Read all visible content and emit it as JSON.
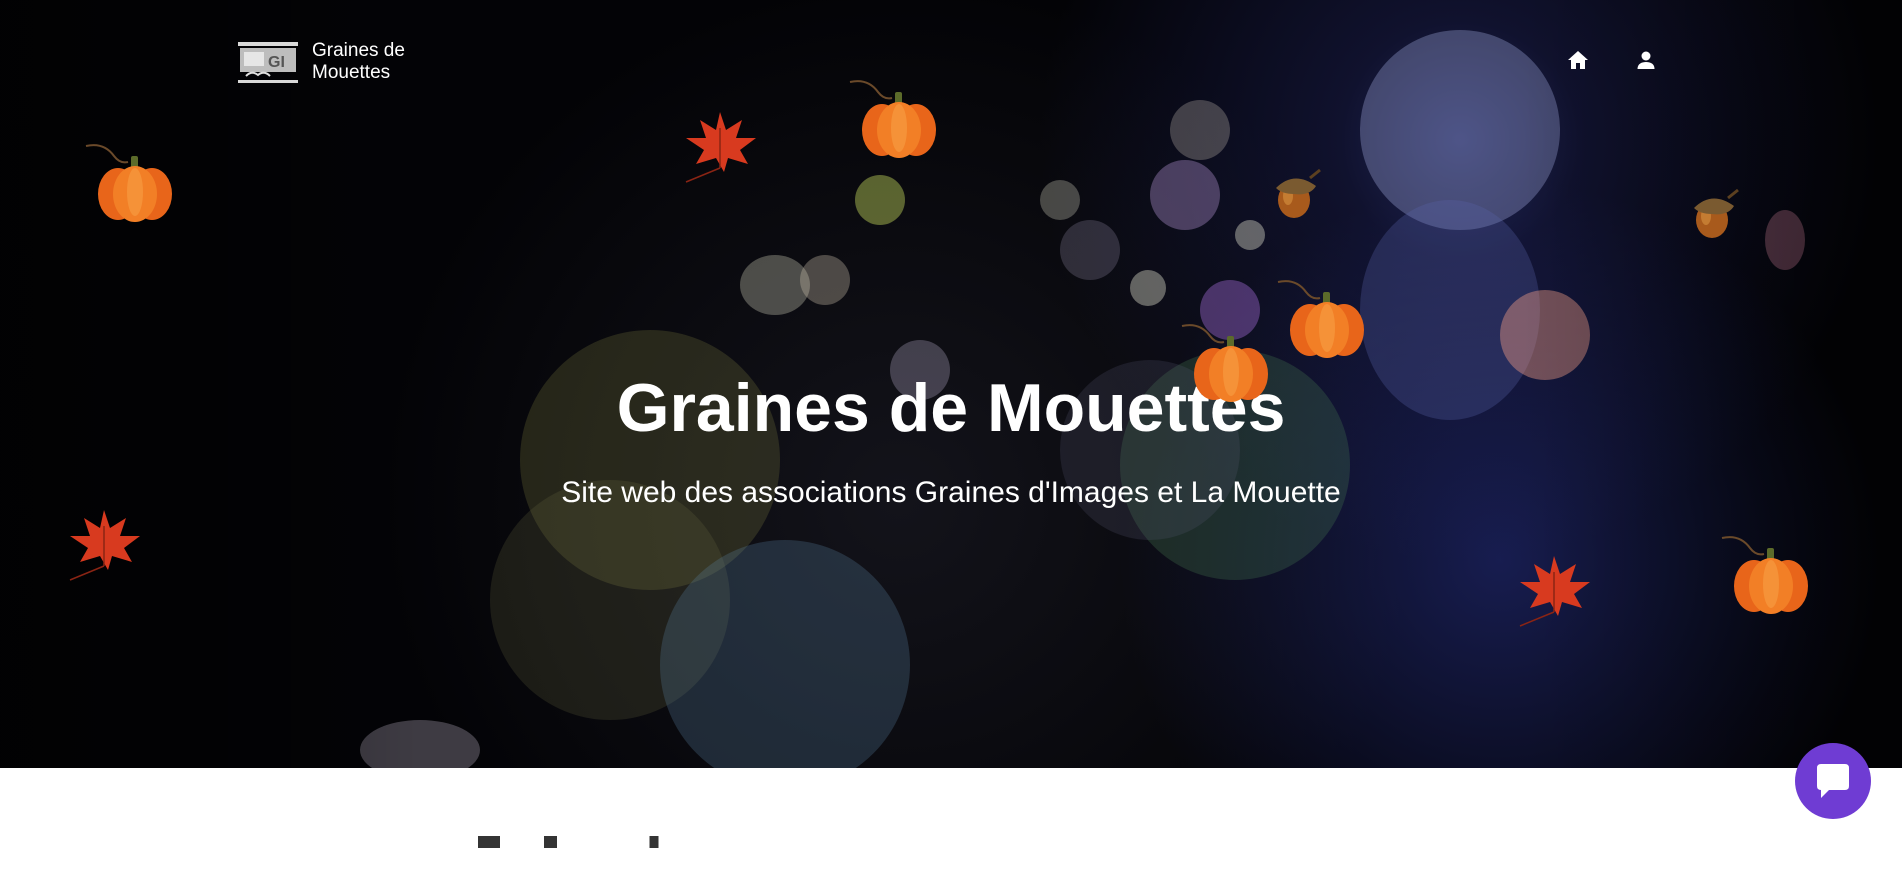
{
  "brand": {
    "name_line1": "Graines de",
    "name_line2": "Mouettes",
    "logo_icon": "graines-mouette-logo"
  },
  "nav": {
    "home_icon": "home-icon",
    "account_icon": "user-icon"
  },
  "hero": {
    "title": "Graines de Mouettes",
    "subtitle": "Site web des associations Graines d'Images et La Mouette",
    "decorations": [
      "pumpkin",
      "maple-leaf",
      "acorn"
    ]
  },
  "chat": {
    "icon": "chat-bubble-icon",
    "color": "#6f3cd3"
  },
  "colors": {
    "hero_background": "#030306",
    "text": "#ffffff",
    "pumpkin": "#f07a22",
    "leaf": "#d83a1f"
  }
}
